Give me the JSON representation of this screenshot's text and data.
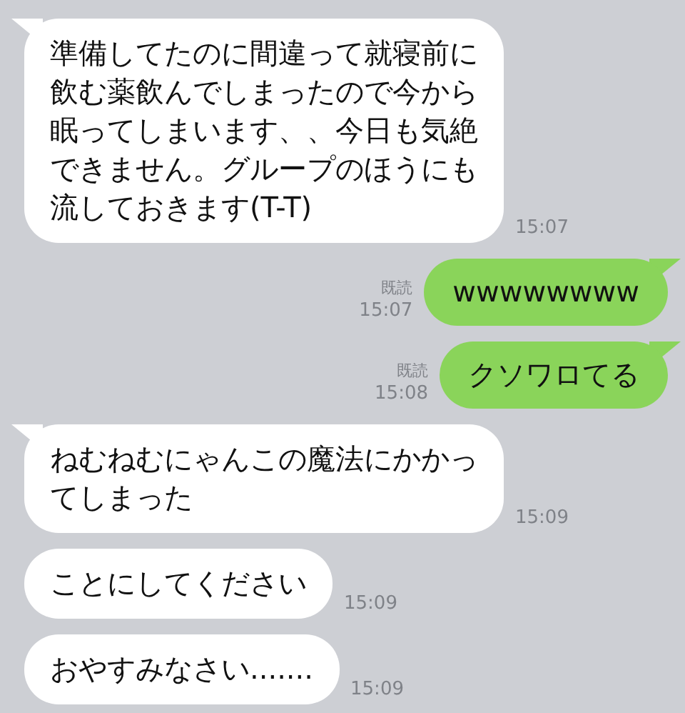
{
  "messages": [
    {
      "kind": "in",
      "tail": true,
      "text": "準備してたのに間違って就寝前に飲む薬飲んでしまったので今から眠ってしまいます、、今日も気絶できません。グループのほうにも流しておきます(T-T)",
      "time": "15:07"
    },
    {
      "kind": "out",
      "tail": true,
      "text": "wwwwwwww",
      "read": "既読",
      "time": "15:07"
    },
    {
      "kind": "out",
      "tail": true,
      "text": "クソワロてる",
      "read": "既読",
      "time": "15:08"
    },
    {
      "kind": "in",
      "tail": true,
      "text": "ねむねむにゃんこの魔法にかかってしまった",
      "time": "15:09"
    },
    {
      "kind": "in",
      "tail": false,
      "text": "ことにしてください",
      "time": "15:09"
    },
    {
      "kind": "in",
      "tail": false,
      "text": "おやすみなさい.......",
      "time": "15:09"
    }
  ]
}
